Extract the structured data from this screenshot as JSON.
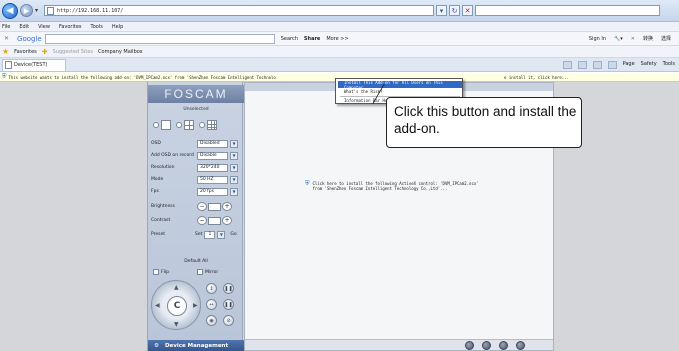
{
  "browser": {
    "address": "http://192.168.11.107/",
    "menu": [
      "File",
      "Edit",
      "View",
      "Favorites",
      "Tools",
      "Help"
    ],
    "toolbar": {
      "google_label": "Google",
      "search_btn": "Search",
      "share_btn": "Share",
      "more_btn": "More >>",
      "sign_in": "Sign In",
      "cn_label_1": "转换",
      "cn_label_2": "选择"
    },
    "favorites": {
      "label": "Favorites",
      "suggested": "Suggested Sites",
      "mailbox": "Company Mailbox"
    },
    "tab_title": "Device(TEST)",
    "command_bar": {
      "page": "Page",
      "safety": "Safety",
      "tools": "Tools"
    },
    "infobar_text": "This website wants to install the following add-on: 'DVM_IPCam2.ocx' from 'ShenZhen Foscam Intelligent Technolo",
    "infobar_rest": "e install it, click here..."
  },
  "popup_menu": {
    "items": [
      "Install This Add-on for All Users on This Computer...",
      "What's the Risk?",
      "Information Bar Help"
    ]
  },
  "callout": {
    "text": "Click this button and install the add-on."
  },
  "panel": {
    "logo": "FOSCAM",
    "unselected": "Unselected",
    "settings": [
      {
        "label": "OSD",
        "value": "Disabled"
      },
      {
        "label": "Add OSD on record",
        "value": "Disable"
      },
      {
        "label": "Resolution",
        "value": "320*240"
      },
      {
        "label": "Mode",
        "value": "50 HZ"
      },
      {
        "label": "Fps",
        "value": "20 fps"
      }
    ],
    "sliders": [
      "Brightness",
      "Contrast"
    ],
    "preset": {
      "label": "Preset",
      "set": "Set",
      "value": "1",
      "go": "Go"
    },
    "default_all": "Default All",
    "flip": "Flip",
    "mirror": "Mirror",
    "ptz_center": "C",
    "device_management": "Device Management"
  },
  "video": {
    "activex_message": "Click here to install the following ActiveX control: 'DVM_IPCam2.ocx' from 'ShenZhen Foscam Intelligent Technology Co.,Ltd'..."
  },
  "colors": {
    "accent": "#316ac5",
    "infobar": "#ffffe1",
    "panel": "#c3cedf",
    "device_bar": "#40629b"
  }
}
